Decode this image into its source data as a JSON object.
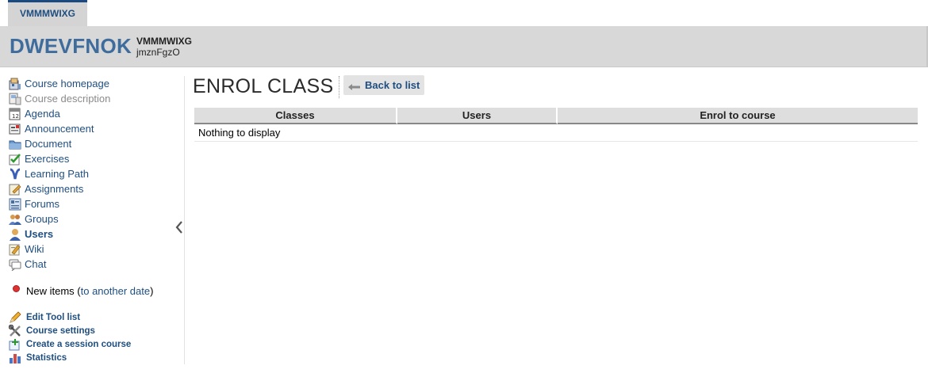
{
  "top_tab": {
    "label": "VMMMWIXG"
  },
  "header": {
    "course_code": "DWEVFNOK",
    "course_name": "VMMMWIXG",
    "course_titular": "jmznFgzO"
  },
  "sidebar": {
    "tools": [
      {
        "label": "Course homepage",
        "icon": "home-icon",
        "state": "normal"
      },
      {
        "label": "Course description",
        "icon": "description-icon",
        "state": "disabled"
      },
      {
        "label": "Agenda",
        "icon": "calendar-icon",
        "state": "normal"
      },
      {
        "label": "Announcement",
        "icon": "announcement-icon",
        "state": "normal"
      },
      {
        "label": "Document",
        "icon": "folder-icon",
        "state": "normal"
      },
      {
        "label": "Exercises",
        "icon": "check-icon",
        "state": "normal"
      },
      {
        "label": "Learning Path",
        "icon": "learning-path-icon",
        "state": "normal"
      },
      {
        "label": "Assignments",
        "icon": "assignment-icon",
        "state": "normal"
      },
      {
        "label": "Forums",
        "icon": "forum-icon",
        "state": "normal"
      },
      {
        "label": "Groups",
        "icon": "groups-icon",
        "state": "normal"
      },
      {
        "label": "Users",
        "icon": "user-icon",
        "state": "active"
      },
      {
        "label": "Wiki",
        "icon": "wiki-icon",
        "state": "normal"
      },
      {
        "label": "Chat",
        "icon": "chat-icon",
        "state": "normal"
      }
    ],
    "new_items": {
      "prefix": "New items (",
      "link": "to another date",
      "suffix": ")"
    },
    "admin": [
      {
        "label": "Edit Tool list",
        "icon": "pencil-icon"
      },
      {
        "label": "Course settings",
        "icon": "tools-icon"
      },
      {
        "label": "Create a session course",
        "icon": "session-icon"
      },
      {
        "label": "Statistics",
        "icon": "statistics-icon"
      }
    ]
  },
  "main": {
    "title": "ENROL CLASS",
    "back_button": "Back to list",
    "table": {
      "headers": [
        "Classes",
        "Users",
        "Enrol to course"
      ],
      "empty_message": "Nothing to display"
    }
  },
  "colors": {
    "link": "#1f4e80",
    "course_code": "#3e6c9c",
    "header_bg": "#d8d8d8"
  }
}
